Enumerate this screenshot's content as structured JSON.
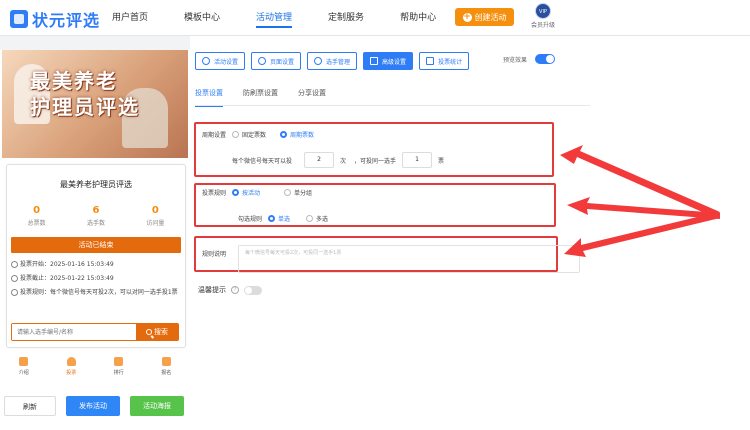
{
  "header": {
    "logo_text": "状元评选",
    "nav": [
      "用户首页",
      "模板中心",
      "活动管理",
      "定制服务",
      "帮助中心"
    ],
    "active_nav": "活动管理",
    "create_button": "创建活动",
    "vip_badge": "VIP",
    "vip_text": "会员升级"
  },
  "preview_panel": {
    "poster_title_line1": "最美养老",
    "poster_title_line2": "护理员评选",
    "activity_title": "最美养老护理员评选",
    "stats": [
      {
        "value": "0",
        "label": "总票数"
      },
      {
        "value": "6",
        "label": "选手数"
      },
      {
        "value": "0",
        "label": "访问量"
      }
    ],
    "ended_label": "活动已结束",
    "vote_start": "投票开始：2025-01-16 15:03:49",
    "vote_end": "投票截止：2025-01-22 15:03:49",
    "vote_rule": "投票规则：每个微信号每天可投2次，可以对同一选手投1票",
    "search_placeholder": "请输入选手编号/名称",
    "search_button": "搜索",
    "tabs": [
      "介绍",
      "投票",
      "排行",
      "报名"
    ],
    "active_tab": "投票"
  },
  "bottom_buttons": {
    "refresh": "刷新",
    "publish": "发布活动",
    "poster": "活动海报"
  },
  "toolbar": {
    "buttons": [
      "活动设置",
      "页面设置",
      "选手管理",
      "高级设置",
      "投票统计"
    ],
    "active": "高级设置",
    "preview_label": "预览效果"
  },
  "subtabs": [
    "投票设置",
    "防刷票设置",
    "分享设置"
  ],
  "active_subtab": "投票设置",
  "cycle_settings": {
    "label": "周期设置",
    "option_fixed": "固定票数",
    "option_cycle": "周期票数",
    "selected": "周期票数",
    "text1": "每个微信号每天可以投",
    "votes_per_day": "2",
    "text2": "次",
    "text3": "，可投同一选手",
    "votes_same": "1",
    "text4": "票"
  },
  "vote_rules": {
    "label": "投票规则",
    "option_by_activity": "按活动",
    "option_by_group": "单分组",
    "selected": "按活动",
    "select_label": "勾选规则",
    "option_single": "单选",
    "option_multi": "多选",
    "select_selected": "单选"
  },
  "rule_desc": {
    "label": "规则说明",
    "placeholder": "每个微信号每天可投2次，可投同一选手1票"
  },
  "warm_tip": {
    "label": "温馨提示",
    "help": "?",
    "enabled": false
  },
  "colors": {
    "primary": "#2f7df6",
    "orange": "#e46b0d",
    "highlight": "#e33b3b",
    "green": "#57c34a"
  }
}
